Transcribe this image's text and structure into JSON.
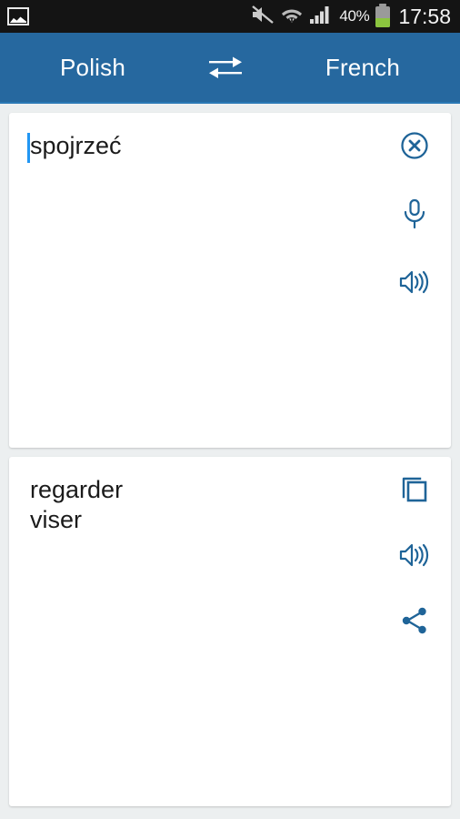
{
  "status_bar": {
    "notification_icon": "gallery-icon",
    "icons": [
      "sound-muted-icon",
      "wifi-icon",
      "cellular-signal-icon"
    ],
    "battery_percent": "40%",
    "battery_level": 40,
    "time": "17:58",
    "background_color": "#141414"
  },
  "header": {
    "source_language": "Polish",
    "target_language": "French",
    "swap_icon": "swap-languages-icon",
    "background_color": "#26689f",
    "text_color": "#ffffff"
  },
  "input_card": {
    "text": "spojrzeć",
    "placeholder": "",
    "has_cursor": true,
    "cursor_color": "#2196f3",
    "actions": [
      {
        "name": "clear-icon",
        "label": "Clear"
      },
      {
        "name": "microphone-icon",
        "label": "Voice input"
      },
      {
        "name": "speaker-icon",
        "label": "Listen"
      }
    ]
  },
  "output_card": {
    "translations": [
      "regarder",
      "viser"
    ],
    "text": "regarder\nviser",
    "actions": [
      {
        "name": "copy-icon",
        "label": "Copy"
      },
      {
        "name": "speaker-icon",
        "label": "Listen"
      },
      {
        "name": "share-icon",
        "label": "Share"
      }
    ]
  },
  "theme": {
    "icon_color": "#1f6498",
    "page_background": "#eceff0",
    "card_background": "#ffffff",
    "text_color": "#1b1b1b"
  }
}
